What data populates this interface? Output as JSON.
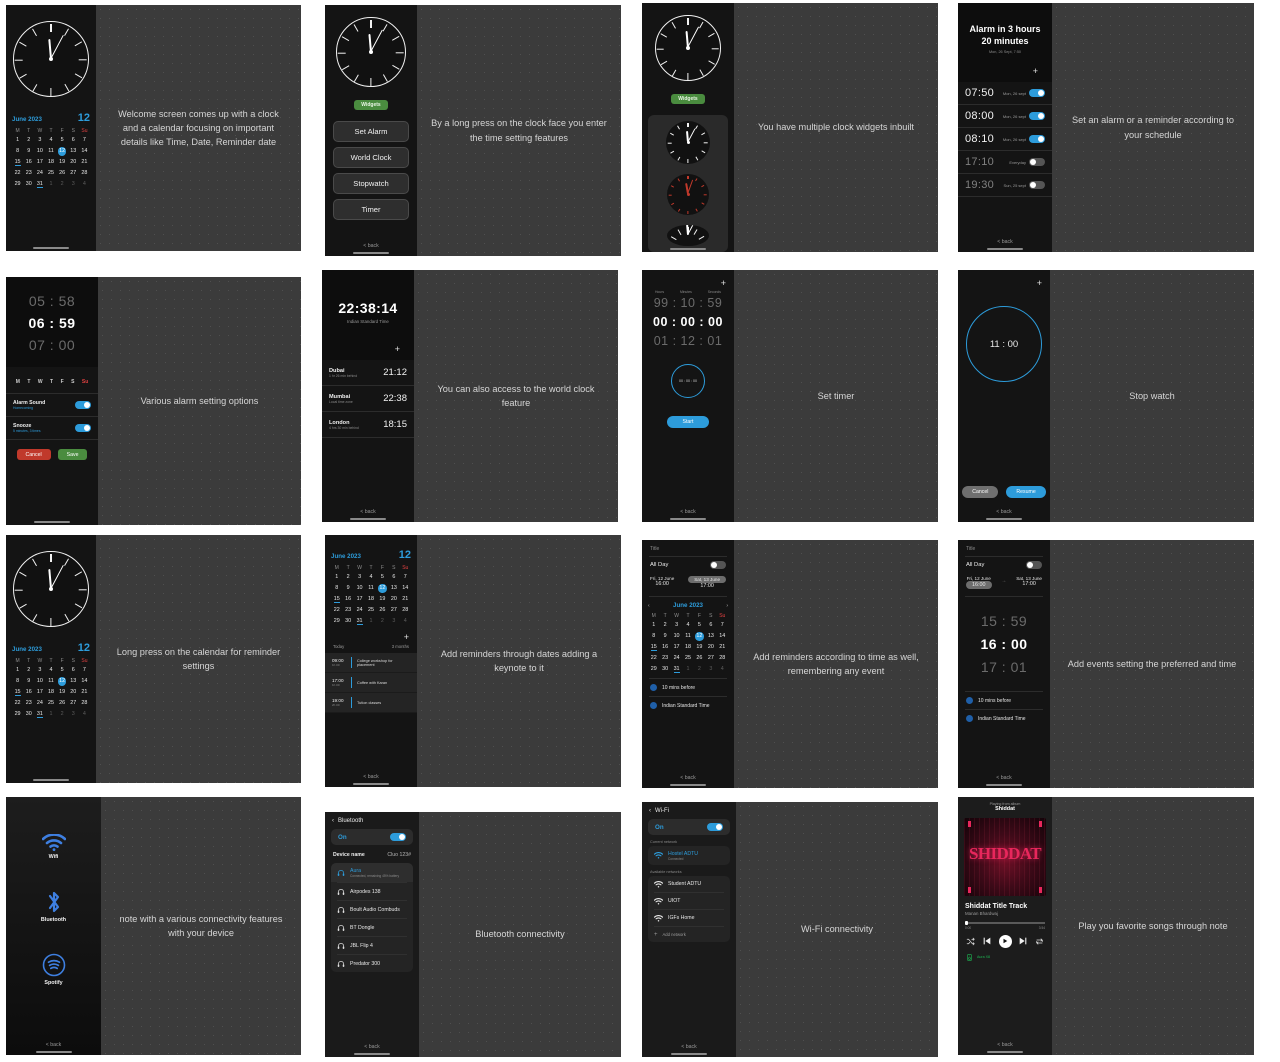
{
  "meta": {
    "accent_blue": "#2d9cdb",
    "accent_green": "#4a8c3f",
    "accent_red": "#c0392b",
    "spotify_green": "#1db954",
    "back_label": "< back"
  },
  "calendar": {
    "month": "June 2023",
    "day_number": "12",
    "dow": [
      "M",
      "T",
      "W",
      "T",
      "F",
      "S",
      "Su"
    ],
    "weeks": [
      [
        "1",
        "2",
        "3",
        "4",
        "5",
        "6",
        "7"
      ],
      [
        "8",
        "9",
        "10",
        "11",
        "12",
        "13",
        "14"
      ],
      [
        "15",
        "16",
        "17",
        "18",
        "19",
        "20",
        "21"
      ],
      [
        "22",
        "23",
        "24",
        "25",
        "26",
        "27",
        "28"
      ],
      [
        "29",
        "30",
        "31",
        "1",
        "2",
        "3",
        "4"
      ]
    ],
    "selected": "12",
    "underlined": [
      "15",
      "31"
    ],
    "today_label": "Today",
    "month_label": "3 months"
  },
  "cards": [
    {
      "id": "welcome",
      "note": "Welcome screen comes up with a clock and a calendar focusing on important details like Time, Date, Reminder date"
    },
    {
      "id": "clock-menu",
      "note": "By a long press on the clock face you enter the time setting features",
      "widgets_badge": "Widgets",
      "menu": [
        "Set Alarm",
        "World Clock",
        "Stopwatch",
        "Timer"
      ]
    },
    {
      "id": "clock-widgets",
      "note": "You have multiple clock widgets inbuilt",
      "widgets_badge": "Widgets"
    },
    {
      "id": "alarm-list",
      "note": "Set an alarm or a reminder according to your schedule",
      "header_title": "Alarm in 3 hours 20 minutes",
      "header_sub": "Mon, 26 Sept, 7:50",
      "alarms": [
        {
          "time": "07:50",
          "sub": "Mon, 26 sept",
          "on": true
        },
        {
          "time": "08:00",
          "sub": "Mon, 26 sept",
          "on": true
        },
        {
          "time": "08:10",
          "sub": "Mon, 26 sept",
          "on": true
        },
        {
          "time": "17:10",
          "sub": "Everyday",
          "on": false
        },
        {
          "time": "19:30",
          "sub": "Sun, 25 sept",
          "on": false
        }
      ]
    },
    {
      "id": "alarm-settings",
      "note": "Various alarm setting options",
      "picker": {
        "prev": "05 : 58",
        "current": "06 : 59",
        "next": "07 : 00"
      },
      "dow": [
        "M",
        "T",
        "W",
        "T",
        "F",
        "S",
        "Su"
      ],
      "options": [
        {
          "label": "Alarm Sound",
          "sub": "Homecoming",
          "on": true
        },
        {
          "label": "Snooze",
          "sub": "5 minutes, 3 times",
          "on": true
        }
      ],
      "cancel": "Cancel",
      "save": "Save"
    },
    {
      "id": "world-clock",
      "note": "You can also access to the world clock feature",
      "main_time": "22:38:14",
      "main_zone": "Indian Standard Time",
      "cities": [
        {
          "name": "Dubai",
          "sub": "1 hr 26 min behind",
          "time": "21:12"
        },
        {
          "name": "Mumbai",
          "sub": "Local time zone",
          "time": "22:38"
        },
        {
          "name": "London",
          "sub": "4 hrs 30 min behind",
          "time": "18:15"
        }
      ]
    },
    {
      "id": "timer",
      "note": "Set timer",
      "col_labels": [
        "Hours",
        "Minutes",
        "Seconds"
      ],
      "picker": {
        "prev": "99 : 10 : 59",
        "current": "00 : 00 : 00",
        "next": "01 : 12 : 01"
      },
      "dial_text": "00 : 00 : 00",
      "start": "Start"
    },
    {
      "id": "stopwatch",
      "note": "Stop watch",
      "dial_time": "11 : 00",
      "cancel": "Cancel",
      "resume": "Resume"
    },
    {
      "id": "calendar-long-press",
      "note": "Long press on the calendar for reminder settings"
    },
    {
      "id": "reminders",
      "note": "Add reminders through dates adding a keynote to it",
      "events": [
        {
          "time": "09:00",
          "dur": "1h 00",
          "title": "College workshop for placement"
        },
        {
          "time": "17:00",
          "dur": "1h 00",
          "title": "Coffee with Karan"
        },
        {
          "time": "19:00",
          "dur": "2h 00",
          "title": "Tution classes"
        }
      ]
    },
    {
      "id": "event-new",
      "note": "Add reminders according to time as well, remembering any event",
      "title_placeholder": "Title",
      "all_day_label": "All Day",
      "all_day_on": false,
      "start_date": "Fri, 12 June",
      "start_time": "16:00",
      "end_date": "Sat, 13 June",
      "end_time": "17:00",
      "reminder": "10 mins before",
      "timezone": "Indian Standard Time"
    },
    {
      "id": "event-time",
      "note": "Add events setting the preferred and time",
      "title_placeholder": "Title",
      "all_day_label": "All Day",
      "start_date": "Fri, 12 June",
      "start_time": "16:00",
      "end_date": "Sat, 13 June",
      "end_time": "17:00",
      "picker": {
        "prev": "15 : 59",
        "current": "16 : 00",
        "next": "17 : 01"
      },
      "reminder": "10 mins before",
      "timezone": "Indian Standard Time"
    },
    {
      "id": "connectivity",
      "note": "note with a various connectivity features with your device",
      "features": [
        {
          "label": "Wifi",
          "icon": "wifi-icon"
        },
        {
          "label": "Bluetooth",
          "icon": "bluetooth-icon"
        },
        {
          "label": "Spotify",
          "icon": "spotify-icon"
        }
      ]
    },
    {
      "id": "bluetooth",
      "note": "Bluetooth connectivity",
      "header": "Bluetooth",
      "state": "On",
      "state_on": true,
      "device_name_label": "Device name",
      "device_name_value": "Cluo 123#",
      "devices": [
        {
          "name": "Aura",
          "sub": "Connected, remaining 45% battery",
          "selected": true
        },
        {
          "name": "Airpodes 138",
          "selected": false
        },
        {
          "name": "Boult Audio Combuds",
          "selected": false
        },
        {
          "name": "BT Dongle",
          "selected": false
        },
        {
          "name": "JBL Flip 4",
          "selected": false
        },
        {
          "name": "Predator 300",
          "selected": false
        }
      ]
    },
    {
      "id": "wifi",
      "note": "Wi-Fi connectivity",
      "header": "Wi-Fi",
      "state": "On",
      "state_on": true,
      "current_label": "Current network",
      "current_network": {
        "name": "Hostel ADTU",
        "sub": "Connected"
      },
      "available_label": "Available networks",
      "networks": [
        "Student ADTU",
        "UIOT",
        "IGFs Home"
      ],
      "add_network": "Add network"
    },
    {
      "id": "spotify",
      "note": "Play you favorite songs through note",
      "playing_from": "Playing from album",
      "album": "Shiddat",
      "track_title": "Shiddat Title Track",
      "artist": "Manan Bhardwaj",
      "elapsed": "0:00",
      "remaining": "3:54",
      "device": "Aura X8",
      "album_art_text": "SHIDDAT"
    }
  ]
}
